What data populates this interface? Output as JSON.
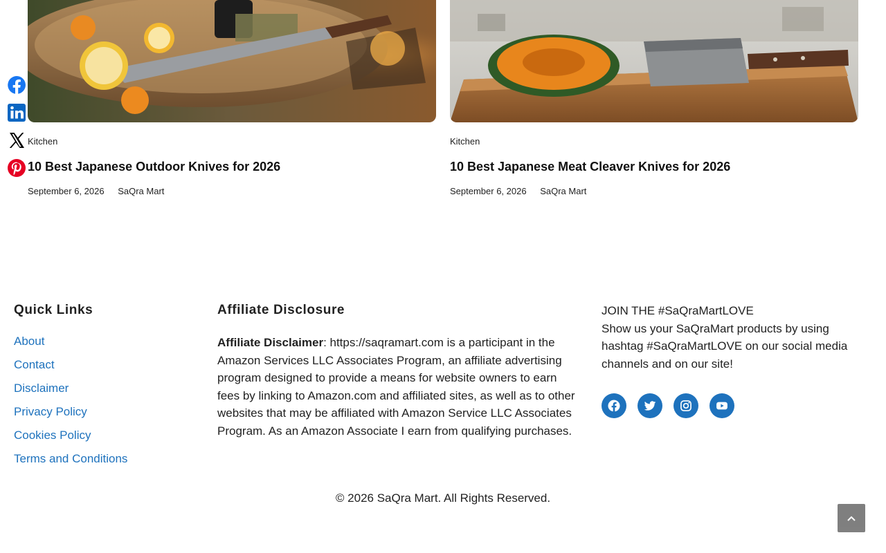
{
  "share": {
    "items": [
      {
        "name": "Facebook",
        "icon": "facebook-icon",
        "color": "#1877f2"
      },
      {
        "name": "LinkedIn",
        "icon": "linkedin-icon",
        "color": "#0a66c2"
      },
      {
        "name": "X",
        "icon": "x-icon",
        "color": "#000000"
      },
      {
        "name": "Pinterest",
        "icon": "pinterest-icon",
        "color": "#e60023"
      }
    ]
  },
  "posts": [
    {
      "category": "Kitchen",
      "title": "10 Best Japanese Outdoor Knives for 2026",
      "date": "September 6, 2026",
      "author": "SaQra Mart"
    },
    {
      "category": "Kitchen",
      "title": "10 Best Japanese Meat Cleaver Knives for 2026",
      "date": "September 6, 2026",
      "author": "SaQra Mart"
    }
  ],
  "footer": {
    "quick_links": {
      "title": "Quick Links",
      "items": [
        "About",
        "Contact",
        "Disclaimer",
        "Privacy Policy",
        "Cookies Policy",
        "Terms and Conditions"
      ]
    },
    "affiliate": {
      "title": "Affiliate Disclosure",
      "label": "Affiliate Disclaimer",
      "text": ": https://saqramart.com is a participant in the Amazon Services LLC Associates Program, an affiliate advertising program designed to provide a means for website owners to earn fees by linking to Amazon.com and affiliated sites, as well as to other websites that may be affiliated with Amazon Service LLC Associates Program. As an Amazon Associate I earn from qualifying purchases."
    },
    "join": {
      "heading": "JOIN THE #SaQraMartLOVE",
      "text": "Show us your SaQraMart products by using hashtag #SaQraMartLOVE on our social media channels and on our site!",
      "social": [
        {
          "name": "Facebook",
          "icon": "facebook-icon"
        },
        {
          "name": "Twitter",
          "icon": "twitter-icon"
        },
        {
          "name": "Instagram",
          "icon": "instagram-icon"
        },
        {
          "name": "YouTube",
          "icon": "youtube-icon"
        }
      ],
      "accent": "#1e72bd"
    },
    "copyright": "© 2026 SaQra Mart. All Rights Reserved."
  }
}
